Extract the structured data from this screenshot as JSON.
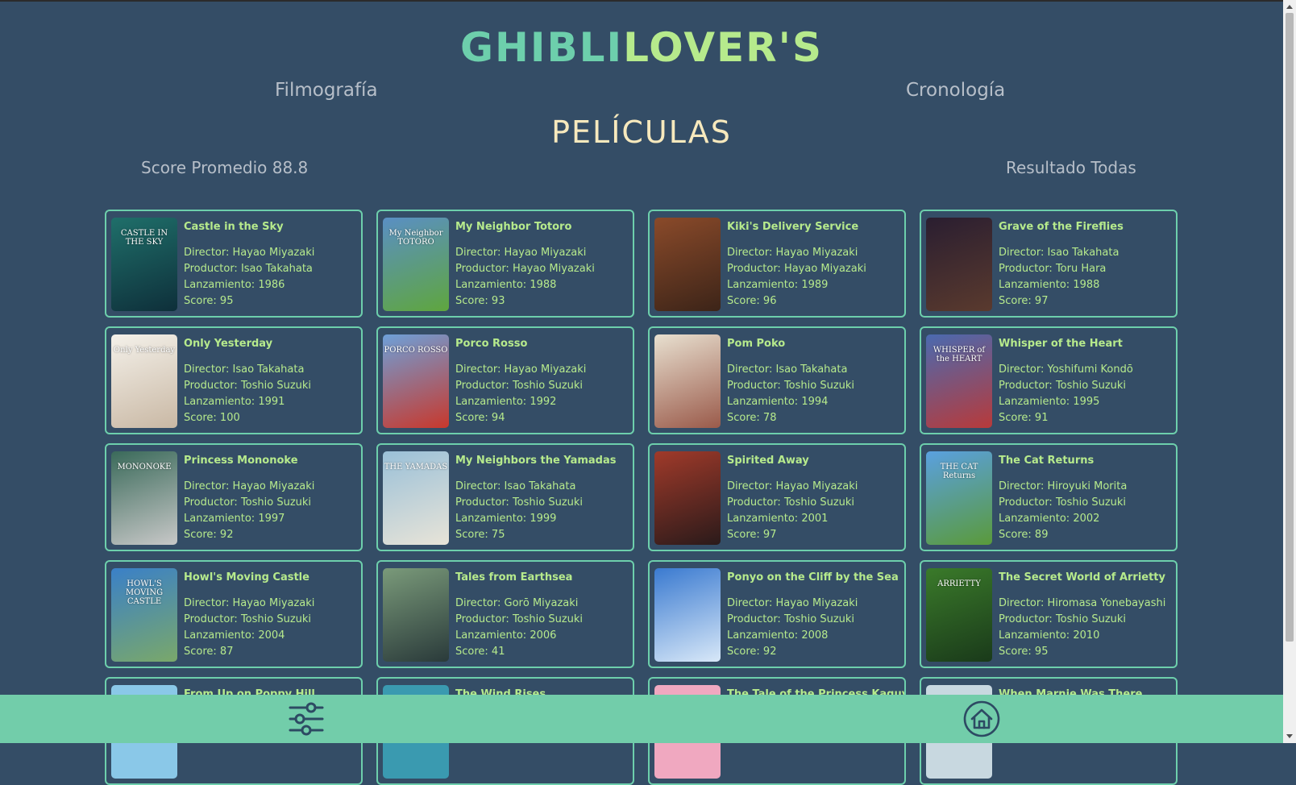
{
  "header": {
    "logo_part1": "GHIBLI",
    "logo_part2": "LOVER'S"
  },
  "nav": {
    "filmografia": "Filmografía",
    "cronologia": "Cronología"
  },
  "section_title": "PELÍCULAS",
  "stats": {
    "score_promedio": "Score Promedio 88.8",
    "resultado": "Resultado Todas"
  },
  "films": [
    {
      "title": "Castle in the Sky",
      "director": "Director: Hayao Miyazaki",
      "productor": "Productor: Isao Takahata",
      "lanzamiento": "Lanzamiento: 1986",
      "score": "Score: 95",
      "poster_text": "CASTLE IN THE SKY",
      "poster_color": "#1f6f6a",
      "poster_color2": "#0e2f3a"
    },
    {
      "title": "My Neighbor Totoro",
      "director": "Director: Hayao Miyazaki",
      "productor": "Productor: Hayao Miyazaki",
      "lanzamiento": "Lanzamiento: 1988",
      "score": "Score: 93",
      "poster_text": "My Neighbor TOTORO",
      "poster_color": "#5a8fc4",
      "poster_color2": "#5fa63e"
    },
    {
      "title": "Kiki's Delivery Service",
      "director": "Director: Hayao Miyazaki",
      "productor": "Productor: Hayao Miyazaki",
      "lanzamiento": "Lanzamiento: 1989",
      "score": "Score: 96",
      "poster_text": "",
      "poster_color": "#8a4a2a",
      "poster_color2": "#3c2418"
    },
    {
      "title": "Grave of the Fireflies",
      "director": "Director: Isao Takahata",
      "productor": "Productor: Toru Hara",
      "lanzamiento": "Lanzamiento: 1988",
      "score": "Score: 97",
      "poster_text": "",
      "poster_color": "#2a1e30",
      "poster_color2": "#5a3a2e"
    },
    {
      "title": "Only Yesterday",
      "director": "Director: Isao Takahata",
      "productor": "Productor: Toshio Suzuki",
      "lanzamiento": "Lanzamiento: 1991",
      "score": "Score: 100",
      "poster_text": "Only Yesterday",
      "poster_color": "#f4f1ea",
      "poster_color2": "#c9b8a4"
    },
    {
      "title": "Porco Rosso",
      "director": "Director: Hayao Miyazaki",
      "productor": "Productor: Toshio Suzuki",
      "lanzamiento": "Lanzamiento: 1992",
      "score": "Score: 94",
      "poster_text": "PORCO ROSSO",
      "poster_color": "#6ea0d8",
      "poster_color2": "#c8382c"
    },
    {
      "title": "Pom Poko",
      "director": "Director: Isao Takahata",
      "productor": "Productor: Toshio Suzuki",
      "lanzamiento": "Lanzamiento: 1994",
      "score": "Score: 78",
      "poster_text": "",
      "poster_color": "#e8e0d0",
      "poster_color2": "#9a5a4a"
    },
    {
      "title": "Whisper of the Heart",
      "director": "Director: Yoshifumi Kondō",
      "productor": "Productor: Toshio Suzuki",
      "lanzamiento": "Lanzamiento: 1995",
      "score": "Score: 91",
      "poster_text": "WHISPER of the HEART",
      "poster_color": "#4a6ab0",
      "poster_color2": "#b83a3a"
    },
    {
      "title": "Princess Mononoke",
      "director": "Director: Hayao Miyazaki",
      "productor": "Productor: Toshio Suzuki",
      "lanzamiento": "Lanzamiento: 1997",
      "score": "Score: 92",
      "poster_text": "MONONOKE",
      "poster_color": "#3a6a5a",
      "poster_color2": "#c8c8c8"
    },
    {
      "title": "My Neighbors the Yamadas",
      "director": "Director: Isao Takahata",
      "productor": "Productor: Toshio Suzuki",
      "lanzamiento": "Lanzamiento: 1999",
      "score": "Score: 75",
      "poster_text": "THE YAMADAS",
      "poster_color": "#9ac0d8",
      "poster_color2": "#e8e4d8"
    },
    {
      "title": "Spirited Away",
      "director": "Director: Hayao Miyazaki",
      "productor": "Productor: Toshio Suzuki",
      "lanzamiento": "Lanzamiento: 2001",
      "score": "Score: 97",
      "poster_text": "",
      "poster_color": "#a03a2a",
      "poster_color2": "#2a1a1a"
    },
    {
      "title": "The Cat Returns",
      "director": "Director: Hiroyuki Morita",
      "productor": "Productor: Toshio Suzuki",
      "lanzamiento": "Lanzamiento: 2002",
      "score": "Score: 89",
      "poster_text": "THE CAT Returns",
      "poster_color": "#5aa0e0",
      "poster_color2": "#5a9a3a"
    },
    {
      "title": "Howl's Moving Castle",
      "director": "Director: Hayao Miyazaki",
      "productor": "Productor: Toshio Suzuki",
      "lanzamiento": "Lanzamiento: 2004",
      "score": "Score: 87",
      "poster_text": "HOWL'S MOVING CASTLE",
      "poster_color": "#3a80c8",
      "poster_color2": "#7aa86a"
    },
    {
      "title": "Tales from Earthsea",
      "director": "Director: Gorō Miyazaki",
      "productor": "Productor: Toshio Suzuki",
      "lanzamiento": "Lanzamiento: 2006",
      "score": "Score: 41",
      "poster_text": "",
      "poster_color": "#7a9a7a",
      "poster_color2": "#2a3a3a"
    },
    {
      "title": "Ponyo on the Cliff by the Sea",
      "director": "Director: Hayao Miyazaki",
      "productor": "Productor: Toshio Suzuki",
      "lanzamiento": "Lanzamiento: 2008",
      "score": "Score: 92",
      "poster_text": "",
      "poster_color": "#3a7ad0",
      "poster_color2": "#d8e8f8"
    },
    {
      "title": "The Secret World of Arrietty",
      "director": "Director: Hiromasa Yonebayashi",
      "productor": "Productor: Toshio Suzuki",
      "lanzamiento": "Lanzamiento: 2010",
      "score": "Score: 95",
      "poster_text": "ARRIETTY",
      "poster_color": "#3a7a2a",
      "poster_color2": "#1a3a1a"
    },
    {
      "title": "From Up on Poppy Hill",
      "director": "",
      "productor": "",
      "lanzamiento": "",
      "score": "",
      "poster_text": "",
      "poster_color": "#8ac8e8",
      "poster_color2": "#8ac8e8"
    },
    {
      "title": "The Wind Rises",
      "director": "",
      "productor": "",
      "lanzamiento": "",
      "score": "",
      "poster_text": "",
      "poster_color": "#3a9ab0",
      "poster_color2": "#3a9ab0"
    },
    {
      "title": "The Tale of the Princess Kaguya",
      "director": "",
      "productor": "",
      "lanzamiento": "",
      "score": "",
      "poster_text": "",
      "poster_color": "#f0a8c0",
      "poster_color2": "#f0a8c0"
    },
    {
      "title": "When Marnie Was There",
      "director": "",
      "productor": "",
      "lanzamiento": "",
      "score": "",
      "poster_text": "",
      "poster_color": "#c8d8e0",
      "poster_color2": "#c8d8e0"
    }
  ],
  "bottom_bar": {
    "filter_icon": "sliders-icon",
    "home_icon": "home-icon"
  },
  "colors": {
    "background": "#344d66",
    "accent": "#6dcfac",
    "accent_light": "#b6ea8c",
    "title_cream": "#f7e9bd",
    "bar": "#72cdaa"
  }
}
